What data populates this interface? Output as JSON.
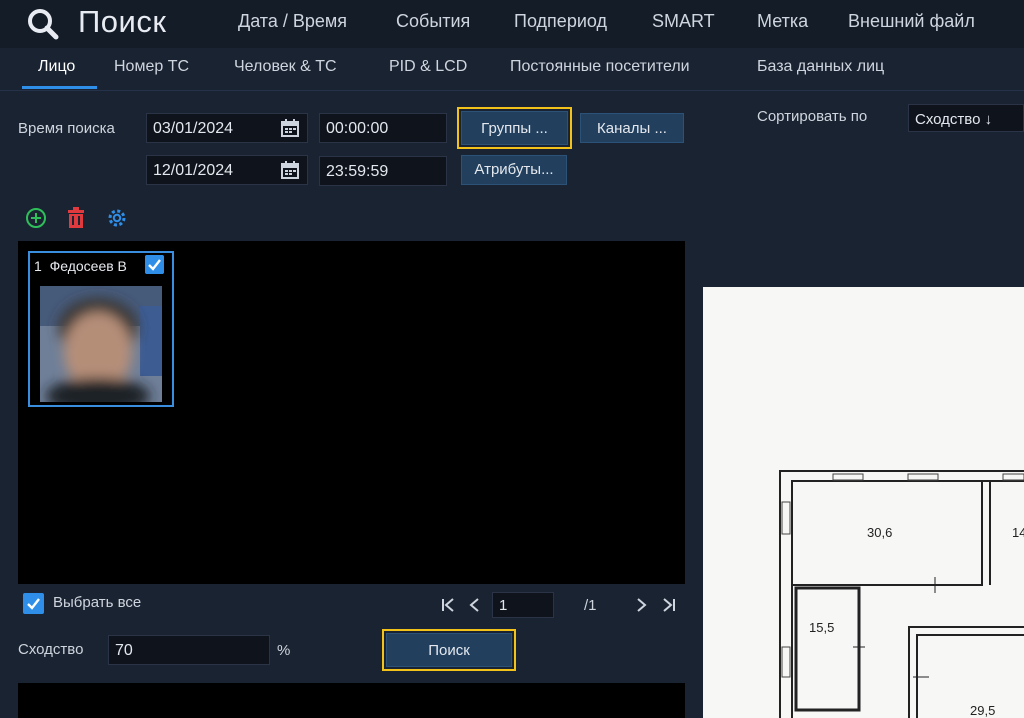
{
  "header": {
    "title": "Поиск",
    "nav": [
      "Дата / Время",
      "События",
      "Подпериод",
      "SMART",
      "Метка",
      "Внешний файл"
    ]
  },
  "subtabs": [
    "Лицо",
    "Номер ТС",
    "Человек & ТС",
    "PID & LCD",
    "Постоянные посетители",
    "База данных лиц"
  ],
  "search_form": {
    "time_label": "Время поиска",
    "start_date": "03/01/2024",
    "start_time": "00:00:00",
    "end_date": "12/01/2024",
    "end_time": "23:59:59",
    "groups_button": "Группы ...",
    "channels_button": "Каналы ...",
    "attributes_button": "Атрибуты..."
  },
  "sort": {
    "label": "Сортировать по",
    "value": "Сходство ↓"
  },
  "faces": [
    {
      "index": "1",
      "name": "Федосеев В",
      "checked": true
    }
  ],
  "select_all": {
    "label": "Выбрать все",
    "checked": true
  },
  "pagination": {
    "current": "1",
    "total": "/1"
  },
  "similarity": {
    "label": "Сходство",
    "value": "70",
    "unit": "%"
  },
  "search_button": "Поиск",
  "floorplan": {
    "rooms": [
      "30,6",
      "14",
      "15,5",
      "29,5"
    ]
  },
  "colors": {
    "accent": "#2f8fe8",
    "highlight": "#f2c21b",
    "add": "#2fbf5a",
    "delete": "#e0393e"
  }
}
